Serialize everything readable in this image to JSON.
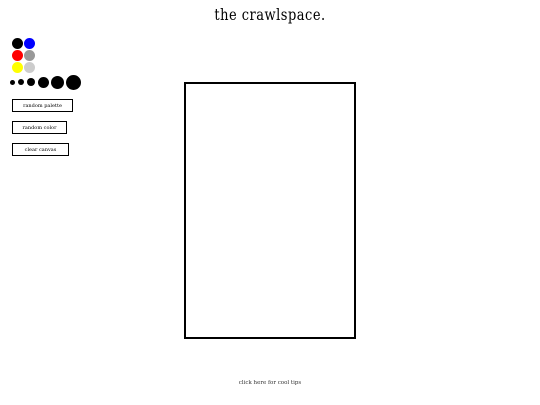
{
  "title": "the crawlspace.",
  "palette": {
    "colors": [
      {
        "name": "black",
        "hex": "#000000"
      },
      {
        "name": "blue",
        "hex": "#0000ff"
      },
      {
        "name": "red",
        "hex": "#ff0000"
      },
      {
        "name": "gray",
        "hex": "#999999"
      },
      {
        "name": "yellow",
        "hex": "#ffff00"
      },
      {
        "name": "light-gray",
        "hex": "#cccccc"
      }
    ]
  },
  "brush_sizes": {
    "count": 6,
    "icon": "circle-dot"
  },
  "buttons": {
    "random_palette": "random palette",
    "random_color": "random color",
    "clear_canvas": "clear canvas"
  },
  "canvas": {
    "background": "#ffffff",
    "border_color": "#000000"
  },
  "footer": {
    "hint": "click here for cool tips"
  }
}
